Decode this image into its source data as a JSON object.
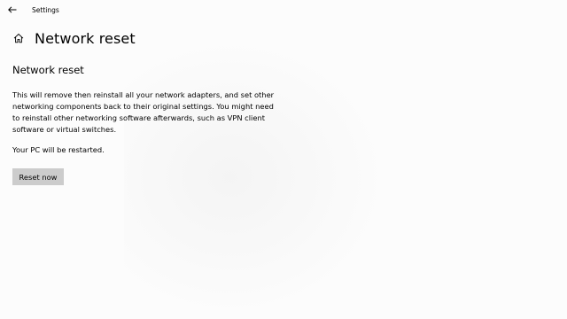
{
  "titlebar": {
    "app_title": "Settings"
  },
  "header": {
    "page_title": "Network reset"
  },
  "main": {
    "section_title": "Network reset",
    "description": "This will remove then reinstall all your network adapters, and set other networking components back to their original settings. You might need to reinstall other networking software afterwards, such as VPN client software or virtual switches.",
    "restart_note": "Your PC will be restarted.",
    "reset_button_label": "Reset now"
  },
  "icons": {
    "back": "back-arrow-icon",
    "home": "home-icon"
  },
  "colors": {
    "background": "#fcfcfc",
    "button_bg": "#cccccc",
    "text": "#000000"
  }
}
